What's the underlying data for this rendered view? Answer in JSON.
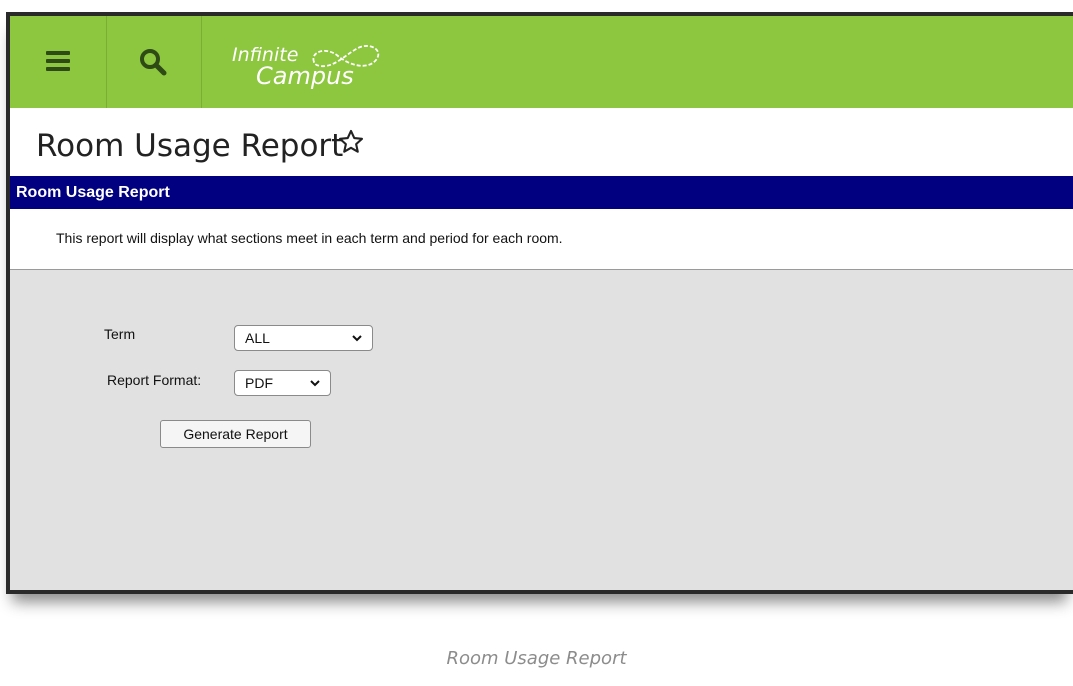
{
  "app": {
    "logo_line1": "Infinite",
    "logo_line2": "Campus",
    "brand_color": "#8dc63f",
    "header_color": "#000080"
  },
  "page": {
    "title": "Room Usage Report"
  },
  "report": {
    "header": "Room Usage Report",
    "description": "This report will display what sections meet in each term and period for each room."
  },
  "form": {
    "term_label": "Term",
    "term_value": "ALL",
    "format_label": "Report Format:",
    "format_value": "PDF",
    "generate_label": "Generate Report"
  },
  "caption": "Room Usage Report"
}
